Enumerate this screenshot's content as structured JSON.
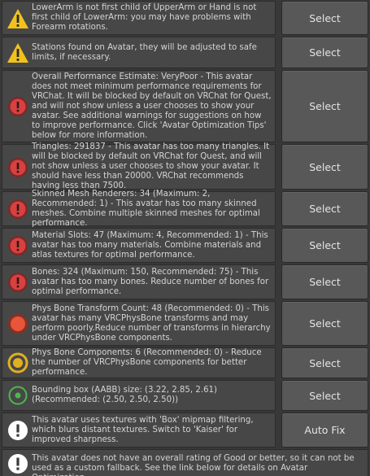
{
  "messages": [
    {
      "icon": "warning-icon",
      "text": "LowerArm is not first child of UpperArm or Hand is not first child of LowerArm: you may have problems with Forearm rotations.",
      "button": "Select"
    },
    {
      "icon": "warning-icon",
      "text": "Stations found on Avatar, they will be adjusted to safe limits, if necessary.",
      "button": "Select"
    },
    {
      "icon": "error-icon",
      "text": "Overall Performance Estimate: VeryPoor - This avatar does not meet minimum performance requirements for VRChat. It will be blocked by default on VRChat for Quest, and will not show unless a user chooses to show your avatar. See additional warnings for suggestions on how to improve performance. Click 'Avatar Optimization Tips' below for more information.",
      "button": "Select"
    },
    {
      "icon": "error-icon",
      "text": "Triangles: 291837 - This avatar has too many triangles. It will be blocked by default on VRChat for Quest, and will not show unless a user chooses to show your avatar. It should have less than 20000. VRChat recommends having less than 7500.",
      "button": "Select"
    },
    {
      "icon": "error-icon",
      "text": "Skinned Mesh Renderers: 34 (Maximum: 2, Recommended: 1) - This avatar has too many skinned meshes. Combine multiple skinned meshes for optimal performance.",
      "button": "Select"
    },
    {
      "icon": "error-icon",
      "text": "Material Slots: 47 (Maximum: 4, Recommended: 1) - This avatar has too many materials. Combine materials and atlas textures for optimal performance.",
      "button": "Select"
    },
    {
      "icon": "error-icon",
      "text": "Bones: 324 (Maximum: 150, Recommended: 75) - This avatar has too many bones. Reduce number of bones for optimal performance.",
      "button": "Select"
    },
    {
      "icon": "physbone-error-icon",
      "text": "Phys Bone Transform Count: 48 (Recommended: 0) - This avatar has many VRCPhysBone transforms and may perform poorly.Reduce number of transforms in hierarchy under VRCPhysBone components.",
      "button": "Select"
    },
    {
      "icon": "physbone-medium-icon",
      "text": "Phys Bone Components: 6 (Recommended: 0) - Reduce the number of VRCPhysBone components for better performance.",
      "button": "Select"
    },
    {
      "icon": "bounds-good-icon",
      "text": "Bounding box (AABB) size: (3.22, 2.85, 2.61) (Recommended: (2.50, 2.50, 2.50))",
      "button": "Select"
    },
    {
      "icon": "info-icon",
      "text": "This avatar uses textures with 'Box' mipmap filtering, which blurs distant textures. Switch to 'Kaiser' for improved sharpness.",
      "button": "Auto Fix"
    },
    {
      "icon": "info-icon",
      "text": "This avatar does not have an overall rating of Good or better, so it can not be used as a custom fallback. See the link below for details on Avatar Optimization.",
      "button": ""
    }
  ],
  "colors": {
    "warning": "#f2c21b",
    "error": "#d94040",
    "error_outer": "#7a2a2a",
    "physbone_error": "#e8553a",
    "medium": "#e0b020",
    "good": "#4cb84c",
    "info": "#ffffff"
  }
}
